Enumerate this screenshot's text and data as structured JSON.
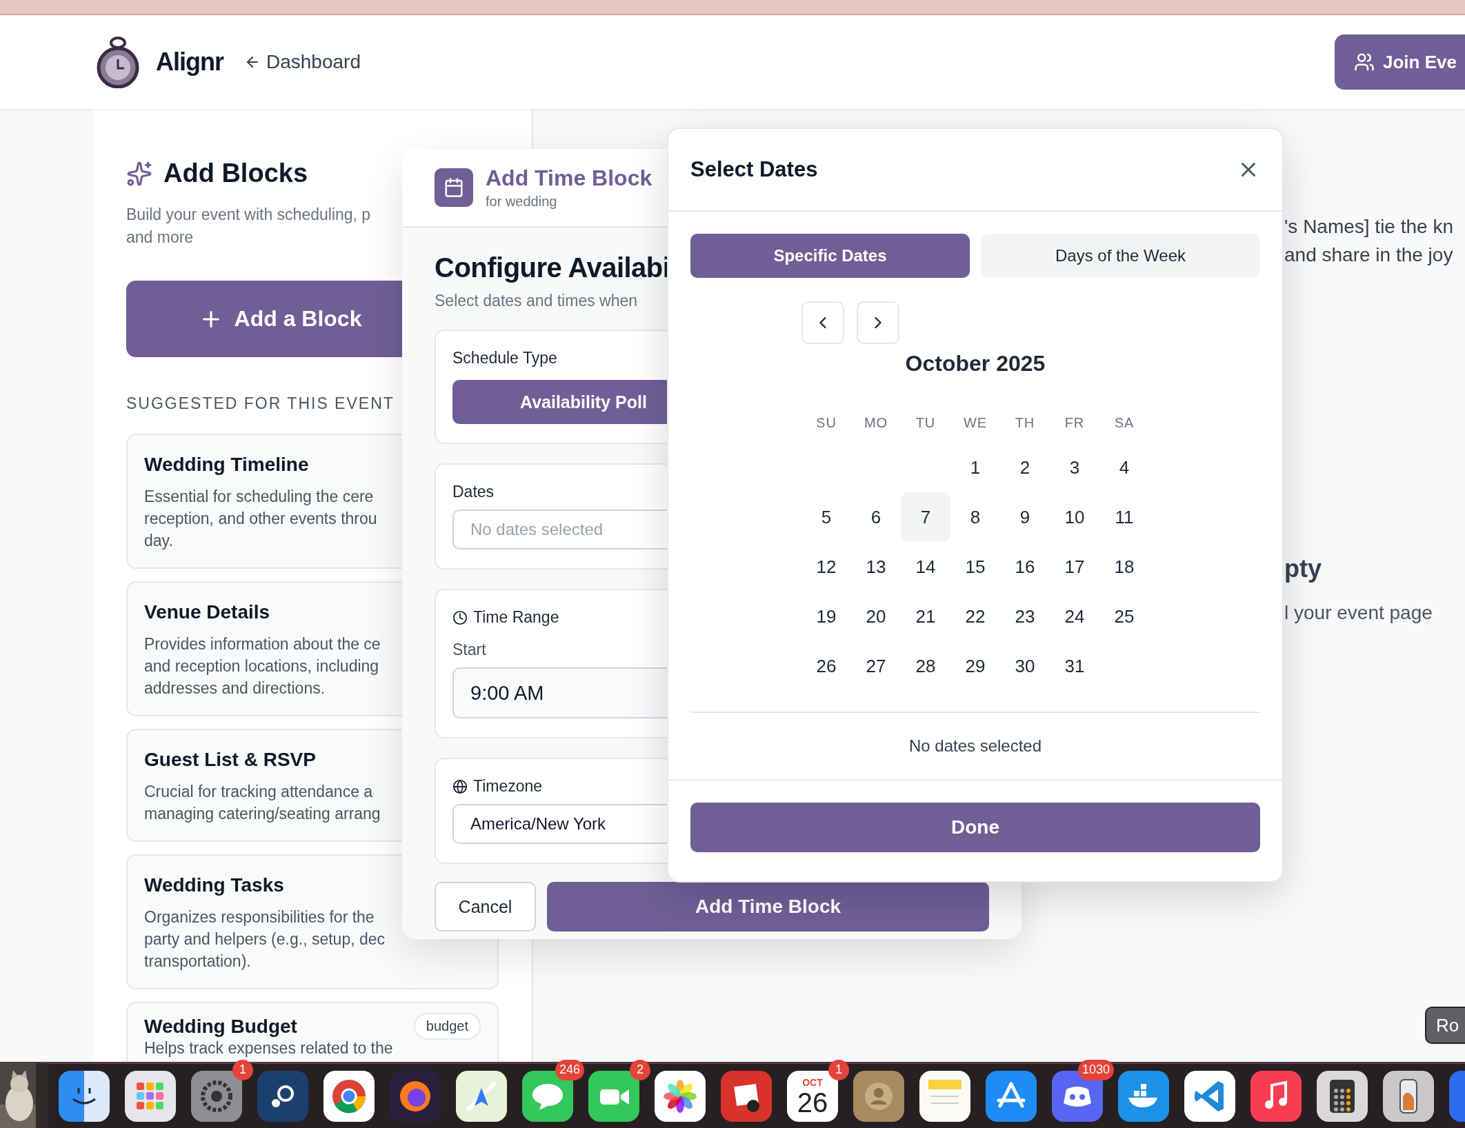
{
  "header": {
    "brand": "Alignr",
    "back_link": "Dashboard",
    "join_button": "Join Eve"
  },
  "add_blocks": {
    "title": "Add Blocks",
    "description": [
      "Build your event with scheduling, p",
      "and more"
    ],
    "add_button": "Add a Block",
    "suggested_heading": "SUGGESTED FOR THIS EVENT",
    "cards": [
      {
        "title": "Wedding Timeline",
        "description": [
          "Essential for scheduling the cere",
          "reception, and other events throu",
          "day."
        ]
      },
      {
        "title": "Venue Details",
        "description": [
          "Provides information about the ce",
          "and reception locations, including",
          "addresses and directions."
        ]
      },
      {
        "title": "Guest List & RSVP",
        "description": [
          "Crucial for tracking attendance a",
          "managing catering/seating arrang"
        ]
      },
      {
        "title": "Wedding Tasks",
        "description": [
          "Organizes responsibilities for the",
          "party and helpers (e.g., setup, dec",
          "transportation)."
        ]
      },
      {
        "title": "Wedding Budget",
        "tag": "budget",
        "description": [
          "Helps track expenses related to the"
        ]
      }
    ]
  },
  "event_page": {
    "intro": [
      "'s Names] tie the kn",
      "and share in the joy"
    ],
    "empty_title": "pty",
    "empty_text": "l your event page"
  },
  "time_block_modal": {
    "title": "Add Time Block",
    "subtitle": "for wedding",
    "heading": "Configure Availabi",
    "description": "Select dates and times when",
    "schedule_type": {
      "label": "Schedule Type",
      "options": [
        {
          "label": "Availability Poll",
          "selected": true
        }
      ]
    },
    "dates": {
      "label": "Dates",
      "placeholder": "No dates selected"
    },
    "time_range": {
      "label": "Time Range",
      "start_label": "Start",
      "start_value": "9:00 AM"
    },
    "timezone": {
      "label": "Timezone",
      "value": "America/New York"
    },
    "cancel_button": "Cancel",
    "submit_button": "Add Time Block"
  },
  "date_picker": {
    "title": "Select Dates",
    "tabs": [
      {
        "label": "Specific Dates",
        "selected": true
      },
      {
        "label": "Days of the Week",
        "selected": false
      }
    ],
    "month": "October 2025",
    "weekdays": [
      "SU",
      "MO",
      "TU",
      "WE",
      "TH",
      "FR",
      "SA"
    ],
    "weeks": [
      [
        {
          "day": "1",
          "today": false,
          "selected": false
        },
        {
          "day": "2",
          "today": false,
          "selected": false
        },
        {
          "day": "3",
          "today": false,
          "selected": false
        },
        {
          "day": "4",
          "today": false,
          "selected": false
        }
      ],
      [
        {
          "day": "5",
          "today": false,
          "selected": false
        },
        {
          "day": "6",
          "today": false,
          "selected": false
        },
        {
          "day": "7",
          "today": true,
          "selected": false
        },
        {
          "day": "8",
          "today": false,
          "selected": false
        },
        {
          "day": "9",
          "today": false,
          "selected": false
        },
        {
          "day": "10",
          "today": false,
          "selected": false
        },
        {
          "day": "11",
          "today": false,
          "selected": false
        }
      ],
      [
        {
          "day": "12",
          "today": false,
          "selected": false
        },
        {
          "day": "13",
          "today": false,
          "selected": false
        },
        {
          "day": "14",
          "today": false,
          "selected": false
        },
        {
          "day": "15",
          "today": false,
          "selected": false
        },
        {
          "day": "16",
          "today": false,
          "selected": false
        },
        {
          "day": "17",
          "today": false,
          "selected": false
        },
        {
          "day": "18",
          "today": false,
          "selected": false
        }
      ],
      [
        {
          "day": "19",
          "today": false,
          "selected": false
        },
        {
          "day": "20",
          "today": false,
          "selected": false
        },
        {
          "day": "21",
          "today": false,
          "selected": false
        },
        {
          "day": "22",
          "today": false,
          "selected": false
        },
        {
          "day": "23",
          "today": false,
          "selected": false
        },
        {
          "day": "24",
          "today": false,
          "selected": false
        },
        {
          "day": "25",
          "today": false,
          "selected": false
        }
      ],
      [
        {
          "day": "26",
          "today": false,
          "selected": false
        },
        {
          "day": "27",
          "today": false,
          "selected": false
        },
        {
          "day": "28",
          "today": false,
          "selected": false
        },
        {
          "day": "29",
          "today": false,
          "selected": false
        },
        {
          "day": "30",
          "today": false,
          "selected": false
        },
        {
          "day": "31",
          "today": false,
          "selected": false
        }
      ]
    ],
    "summary": "No dates selected",
    "done_button": "Done"
  },
  "corner_button": "Ro",
  "dock": [
    {
      "kind": "picture"
    },
    {
      "kind": "finder"
    },
    {
      "kind": "launchpad"
    },
    {
      "kind": "settings",
      "badge": "1"
    },
    {
      "kind": "steam"
    },
    {
      "kind": "chrome"
    },
    {
      "kind": "firefox"
    },
    {
      "kind": "maps"
    },
    {
      "kind": "messages",
      "badge": "246"
    },
    {
      "kind": "facetime",
      "badge": "2"
    },
    {
      "kind": "photos"
    },
    {
      "kind": "photobooth"
    },
    {
      "kind": "calendar",
      "month": "OCT",
      "day": "26",
      "badge": "1"
    },
    {
      "kind": "contacts"
    },
    {
      "kind": "notes"
    },
    {
      "kind": "appstore"
    },
    {
      "kind": "discord",
      "badge": "1030"
    },
    {
      "kind": "docker"
    },
    {
      "kind": "vscode"
    },
    {
      "kind": "music"
    },
    {
      "kind": "calculator"
    },
    {
      "kind": "iphone"
    },
    {
      "kind": "blank"
    }
  ]
}
